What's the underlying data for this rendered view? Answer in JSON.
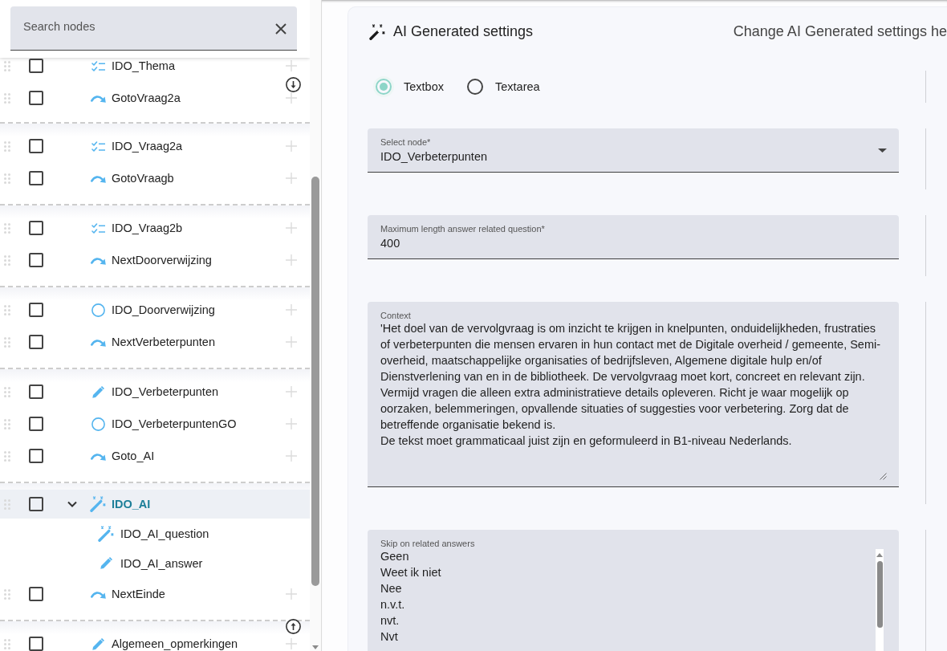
{
  "search": {
    "placeholder": "Search nodes"
  },
  "tree": {
    "groups": [
      {
        "nodes": [
          {
            "label": "IDO_Thema",
            "kind": "checklist",
            "checked": false,
            "selected": false
          },
          {
            "label": "GotoVraag2a",
            "kind": "goto",
            "checked": false,
            "selected": false
          }
        ]
      },
      {
        "nodes": [
          {
            "label": "IDO_Vraag2a",
            "kind": "checklist",
            "checked": false,
            "selected": false
          },
          {
            "label": "GotoVraagb",
            "kind": "goto",
            "checked": false,
            "selected": false
          }
        ]
      },
      {
        "nodes": [
          {
            "label": "IDO_Vraag2b",
            "kind": "checklist",
            "checked": false,
            "selected": false
          },
          {
            "label": "NextDoorverwijzing",
            "kind": "goto",
            "checked": false,
            "selected": false
          }
        ]
      },
      {
        "nodes": [
          {
            "label": "IDO_Doorverwijzing",
            "kind": "choice",
            "checked": false,
            "selected": false
          },
          {
            "label": "NextVerbeterpunten",
            "kind": "goto",
            "checked": false,
            "selected": false
          }
        ]
      },
      {
        "nodes": [
          {
            "label": "IDO_Verbeterpunten",
            "kind": "text",
            "checked": false,
            "selected": false
          },
          {
            "label": "IDO_VerbeterpuntenGO",
            "kind": "choice",
            "checked": false,
            "selected": false
          },
          {
            "label": "Goto_AI",
            "kind": "goto",
            "checked": false,
            "selected": false
          }
        ]
      },
      {
        "nodes": [
          {
            "label": "IDO_AI",
            "kind": "ai",
            "checked": false,
            "selected": true,
            "expanded": true,
            "children": [
              {
                "label": "IDO_AI_question",
                "kind": "ai",
                "selected": false
              },
              {
                "label": "IDO_AI_answer",
                "kind": "text",
                "selected": false
              }
            ]
          },
          {
            "label": "NextEinde",
            "kind": "goto",
            "checked": false,
            "selected": false
          }
        ]
      },
      {
        "nodes": [
          {
            "label": "Algemeen_opmerkingen",
            "kind": "text",
            "checked": false,
            "selected": false
          }
        ]
      }
    ]
  },
  "settings": {
    "title": "AI Generated settings",
    "description": "Change AI Generated settings he",
    "input_type": [
      {
        "label": "Textbox",
        "selected": true
      },
      {
        "label": "Textarea",
        "selected": false
      }
    ],
    "fields": [
      {
        "kind": "select",
        "label": "Select node*",
        "value": "IDO_Verbeterpunten"
      },
      {
        "kind": "text",
        "label": "Maximum length answer related question*",
        "value": "400"
      },
      {
        "kind": "textarea",
        "label": "Context",
        "value": "'Het doel van de vervolgvraag is om inzicht te krijgen in knelpunten, onduidelijkheden, frustraties of verbeterpunten die mensen ervaren in hun contact met de Digitale overheid / gemeente, Semi-overheid, maatschappelijke organisaties of bedrijfsleven, Algemene digitale hulp en/of Dienstverlening van en in de bibliotheek. De vervolgvraag moet kort, concreet en relevant zijn. Vermijd vragen die alleen extra administratieve details opleveren. Richt je waar mogelijk op oorzaken, belemmeringen, opvallende situaties of suggesties voor verbetering. Zorg dat de betreffende organisatie bekend is.\nDe tekst moet grammaticaal juist zijn en geformuleerd in B1-niveau Nederlands."
      },
      {
        "kind": "list",
        "label": "Skip on related answers",
        "value": "Geen\nWeet ik niet\nNee\nn.v.t.\nnvt.\nNvt"
      }
    ]
  }
}
